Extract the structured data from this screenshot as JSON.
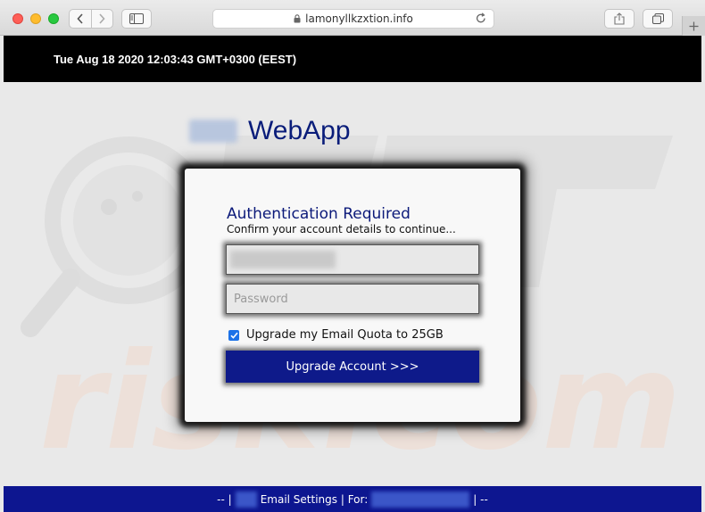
{
  "browser": {
    "address": "lamonyllkzxtion.info"
  },
  "page": {
    "date_text": "Tue Aug 18 2020 12:03:43 GMT+0300 (EEST)",
    "brand_name": "WebApp",
    "heading": "Authentication Required",
    "subheading": "Confirm your account details to continue...",
    "password_placeholder": "Password",
    "checkbox_label": "Upgrade my Email Quota to 25GB",
    "button_label": "Upgrade Account >>>",
    "footer": {
      "prefix": "-- |",
      "label": "Email Settings | For:",
      "suffix": "| --"
    }
  },
  "colors": {
    "brand_blue": "#0a1d7a",
    "button_blue": "#0e1a8a",
    "footer_blue": "#0d1690",
    "checkbox_blue": "#1d72e8"
  }
}
